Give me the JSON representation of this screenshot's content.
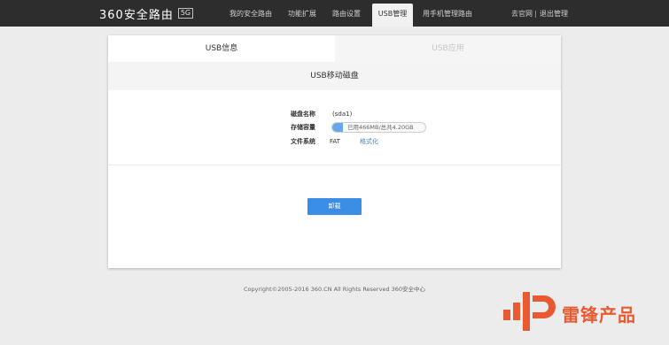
{
  "header": {
    "logo_text": "360安全路由",
    "logo_badge": "5G",
    "nav": [
      {
        "label": "我的安全路由"
      },
      {
        "label": "功能扩展"
      },
      {
        "label": "路由设置"
      },
      {
        "label": "USB管理",
        "active": true
      },
      {
        "label": "用手机管理路由"
      }
    ],
    "right_links": {
      "official_site": "去官网",
      "logout": "退出管理"
    }
  },
  "tabs": [
    {
      "label": "USB信息",
      "active": true
    },
    {
      "label": "USB应用",
      "active": false
    }
  ],
  "section_title": "USB移动磁盘",
  "disk": {
    "name_label": "磁盘名称",
    "name_value": "(sda1)",
    "capacity_label": "存储容量",
    "usage_text": "已用466MB/总共4.20GB",
    "usage_fraction": 0.11,
    "fs_label": "文件系统",
    "fs_value": "FAT",
    "format_link": "格式化"
  },
  "unmount_button": "卸载",
  "footer": "Copyright©2005-2016 360.CN All Rights Reserved 360安全中心",
  "watermark": {
    "text": "雷锋产品"
  },
  "colors": {
    "topbar": "#2d2d2d",
    "accent": "#3a8ee6",
    "usage_fill": "#6aa6ea",
    "watermark": "#e85a32"
  }
}
